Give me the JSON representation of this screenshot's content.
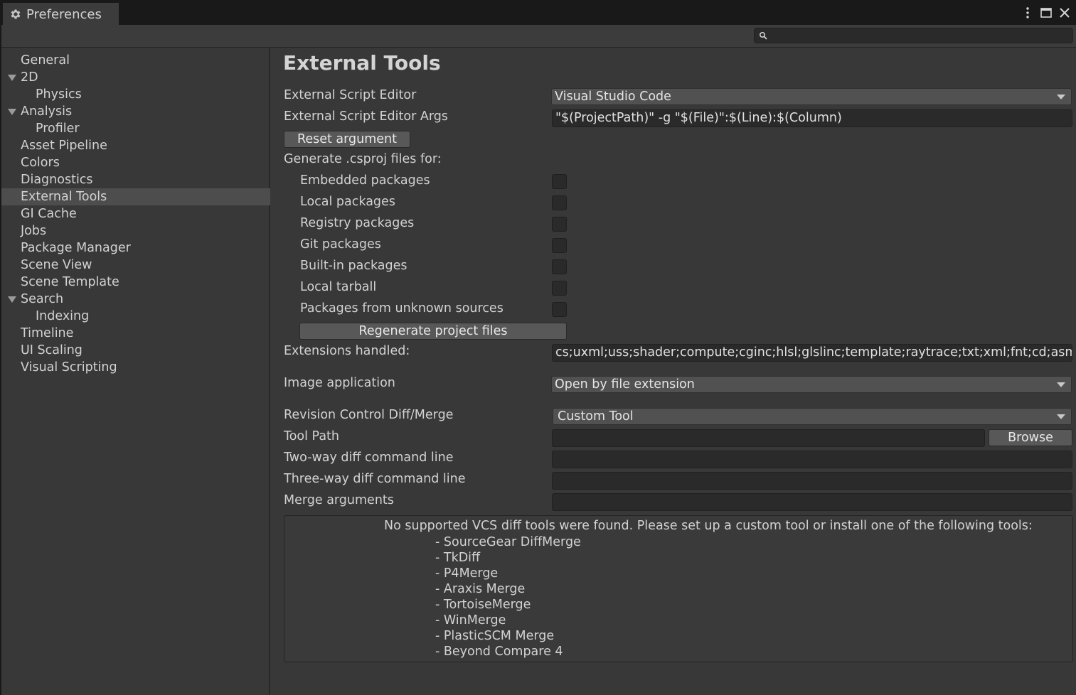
{
  "window": {
    "tab_title": "Preferences"
  },
  "search": {
    "value": "",
    "placeholder": ""
  },
  "sidebar": {
    "items": [
      {
        "label": "General",
        "indent": 0,
        "expanded": null,
        "selected": false
      },
      {
        "label": "2D",
        "indent": 0,
        "expanded": true,
        "selected": false
      },
      {
        "label": "Physics",
        "indent": 1,
        "expanded": null,
        "selected": false
      },
      {
        "label": "Analysis",
        "indent": 0,
        "expanded": true,
        "selected": false
      },
      {
        "label": "Profiler",
        "indent": 1,
        "expanded": null,
        "selected": false
      },
      {
        "label": "Asset Pipeline",
        "indent": 0,
        "expanded": null,
        "selected": false
      },
      {
        "label": "Colors",
        "indent": 0,
        "expanded": null,
        "selected": false
      },
      {
        "label": "Diagnostics",
        "indent": 0,
        "expanded": null,
        "selected": false
      },
      {
        "label": "External Tools",
        "indent": 0,
        "expanded": null,
        "selected": true
      },
      {
        "label": "GI Cache",
        "indent": 0,
        "expanded": null,
        "selected": false
      },
      {
        "label": "Jobs",
        "indent": 0,
        "expanded": null,
        "selected": false
      },
      {
        "label": "Package Manager",
        "indent": 0,
        "expanded": null,
        "selected": false
      },
      {
        "label": "Scene View",
        "indent": 0,
        "expanded": null,
        "selected": false
      },
      {
        "label": "Scene Template",
        "indent": 0,
        "expanded": null,
        "selected": false
      },
      {
        "label": "Search",
        "indent": 0,
        "expanded": true,
        "selected": false
      },
      {
        "label": "Indexing",
        "indent": 1,
        "expanded": null,
        "selected": false
      },
      {
        "label": "Timeline",
        "indent": 0,
        "expanded": null,
        "selected": false
      },
      {
        "label": "UI Scaling",
        "indent": 0,
        "expanded": null,
        "selected": false
      },
      {
        "label": "Visual Scripting",
        "indent": 0,
        "expanded": null,
        "selected": false
      }
    ]
  },
  "main": {
    "title": "External Tools",
    "script_editor": {
      "label": "External Script Editor",
      "value": "Visual Studio Code"
    },
    "script_editor_args": {
      "label": "External Script Editor Args",
      "value": "\"$(ProjectPath)\" -g \"$(File)\":$(Line):$(Column)"
    },
    "reset_button": "Reset argument",
    "csproj_header": "Generate .csproj files for:",
    "csproj_options": [
      {
        "label": "Embedded packages",
        "checked": false
      },
      {
        "label": "Local packages",
        "checked": false
      },
      {
        "label": "Registry packages",
        "checked": false
      },
      {
        "label": "Git packages",
        "checked": false
      },
      {
        "label": "Built-in packages",
        "checked": false
      },
      {
        "label": "Local tarball",
        "checked": false
      },
      {
        "label": "Packages from unknown sources",
        "checked": false
      }
    ],
    "regenerate_button": "Regenerate project files",
    "extensions": {
      "label": "Extensions handled:",
      "value": "cs;uxml;uss;shader;compute;cginc;hlsl;glslinc;template;raytrace;txt;xml;fnt;cd;asmdef;asmref;rsp"
    },
    "image_app": {
      "label": "Image application",
      "value": "Open by file extension"
    },
    "revision": {
      "label": "Revision Control Diff/Merge",
      "value": "Custom Tool"
    },
    "tool_path": {
      "label": "Tool Path",
      "value": "",
      "browse": "Browse"
    },
    "two_way": {
      "label": "Two-way diff command line",
      "value": ""
    },
    "three_way": {
      "label": "Three-way diff command line",
      "value": ""
    },
    "merge_args": {
      "label": "Merge arguments",
      "value": ""
    },
    "help": {
      "message": "No supported VCS diff tools were found. Please set up a custom tool or install one of the following tools:",
      "tools": [
        "- SourceGear DiffMerge",
        "- TkDiff",
        "- P4Merge",
        "- Araxis Merge",
        "- TortoiseMerge",
        "- WinMerge",
        "- PlasticSCM Merge",
        "- Beyond Compare 4"
      ]
    }
  },
  "icons": {
    "tab": "gear-icon",
    "search": "magnifier-icon",
    "window_controls": [
      "kebab-menu-icon",
      "maximize-icon",
      "close-icon"
    ]
  },
  "colors": {
    "window_bg": "#383838",
    "titlebar_bg": "#191919",
    "field_bg": "#2a2a2a",
    "selected_bg": "#4d4d4d",
    "text": "#d2d2d2"
  }
}
